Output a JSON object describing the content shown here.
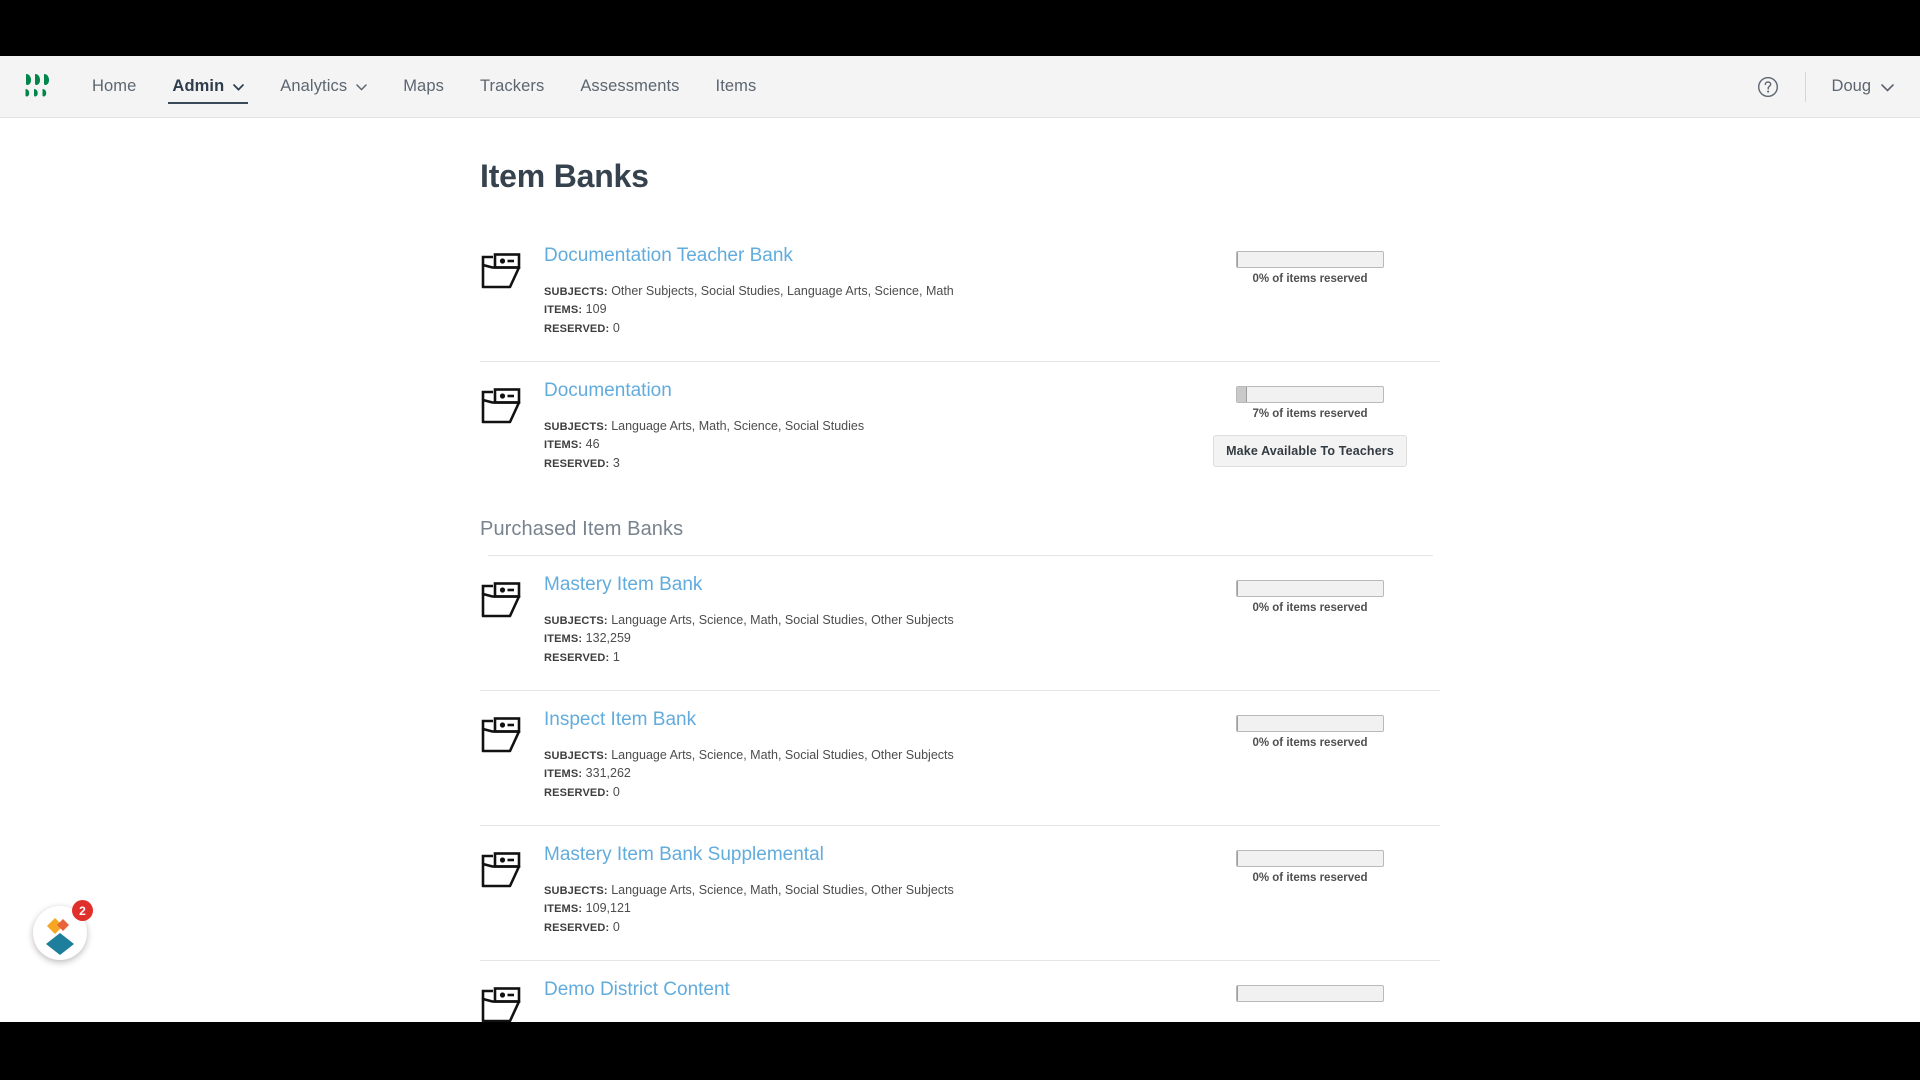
{
  "navbar": {
    "logo_name": "product-logo",
    "items": [
      {
        "label": "Home",
        "has_caret": false,
        "active": false
      },
      {
        "label": "Admin",
        "has_caret": true,
        "active": true
      },
      {
        "label": "Analytics",
        "has_caret": true,
        "active": false
      },
      {
        "label": "Maps",
        "has_caret": false,
        "active": false
      },
      {
        "label": "Trackers",
        "has_caret": false,
        "active": false
      },
      {
        "label": "Assessments",
        "has_caret": false,
        "active": false
      },
      {
        "label": "Items",
        "has_caret": false,
        "active": false
      }
    ],
    "help_icon": "question-circle-icon",
    "user_label": "Doug"
  },
  "page": {
    "title": "Item Banks",
    "section_heading": "Purchased Item Banks",
    "labels": {
      "subjects": "SUBJECTS:",
      "items": "ITEMS:",
      "reserved": "RESERVED:"
    },
    "make_available_label": "Make Available To Teachers"
  },
  "owned_banks": [
    {
      "name": "Documentation Teacher Bank",
      "subjects": "Other Subjects, Social Studies, Language Arts, Science, Math",
      "items": "109",
      "reserved": "0",
      "reserved_pct": 0,
      "reserved_label": "0% of items reserved",
      "has_make_available": false
    },
    {
      "name": "Documentation",
      "subjects": "Language Arts, Math, Science, Social Studies",
      "items": "46",
      "reserved": "3",
      "reserved_pct": 7,
      "reserved_label": "7% of items reserved",
      "has_make_available": true
    }
  ],
  "purchased_banks": [
    {
      "name": "Mastery Item Bank",
      "subjects": "Language Arts, Science, Math, Social Studies, Other Subjects",
      "items": "132,259",
      "reserved": "1",
      "reserved_pct": 0,
      "reserved_label": "0% of items reserved",
      "has_make_available": false
    },
    {
      "name": "Inspect Item Bank",
      "subjects": "Language Arts, Science, Math, Social Studies, Other Subjects",
      "items": "331,262",
      "reserved": "0",
      "reserved_pct": 0,
      "reserved_label": "0% of items reserved",
      "has_make_available": false
    },
    {
      "name": "Mastery Item Bank Supplemental",
      "subjects": "Language Arts, Science, Math, Social Studies, Other Subjects",
      "items": "109,121",
      "reserved": "0",
      "reserved_pct": 0,
      "reserved_label": "0% of items reserved",
      "has_make_available": false
    },
    {
      "name": "Demo District Content",
      "subjects": "",
      "items": "",
      "reserved": "",
      "reserved_pct": 0,
      "reserved_label": "",
      "has_make_available": false,
      "clipped": true
    }
  ],
  "support_widget": {
    "icon_name": "support-chat-widget",
    "badge_count": "2",
    "colors": {
      "top": "#f5a623",
      "top_right": "#e8623a",
      "bottom": "#1d7f9b"
    }
  },
  "colors": {
    "nav_bg": "#f4f4f4",
    "link_blue": "#62acdd",
    "title_dark": "#36434f",
    "logo_green": "#00854a",
    "badge_red": "#e0302c"
  }
}
